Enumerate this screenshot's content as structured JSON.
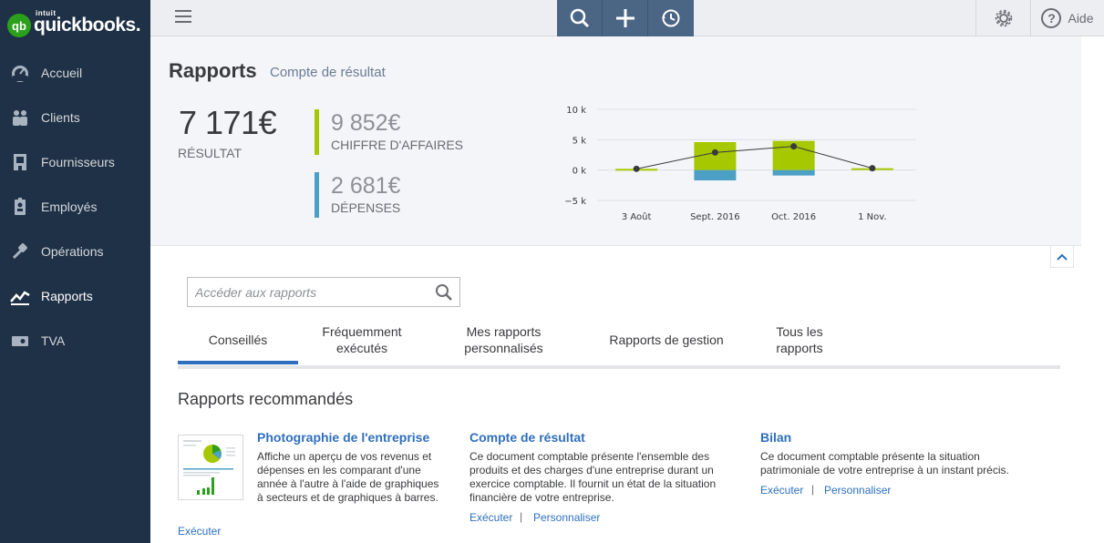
{
  "app": {
    "logo_badge": "qb",
    "logo_intuit": "intuit",
    "logo_name": "quickbooks."
  },
  "sidebar": {
    "items": [
      {
        "label": "Accueil",
        "icon": "dashboard-icon"
      },
      {
        "label": "Clients",
        "icon": "customers-icon"
      },
      {
        "label": "Fournisseurs",
        "icon": "vendors-icon"
      },
      {
        "label": "Employés",
        "icon": "employees-icon"
      },
      {
        "label": "Opérations",
        "icon": "transactions-icon"
      },
      {
        "label": "Rapports",
        "icon": "reports-icon",
        "active": true
      },
      {
        "label": "TVA",
        "icon": "tax-icon"
      }
    ]
  },
  "topbar": {
    "help_label": "Aide",
    "help_glyph": "?"
  },
  "header": {
    "title": "Rapports",
    "subtitle": "Compte de résultat",
    "result_value": "7 171€",
    "result_label": "RÉSULTAT",
    "revenue_value": "9 852€",
    "revenue_label": "CHIFFRE D'AFFAIRES",
    "expenses_value": "2 681€",
    "expenses_label": "DÉPENSES"
  },
  "chart_data": {
    "type": "bar",
    "categories": [
      "3 Août",
      "Sept. 2016",
      "Oct. 2016",
      "1 Nov."
    ],
    "series": [
      {
        "values": [
          200,
          4600,
          4800,
          300
        ],
        "color": "#a6c800"
      },
      {
        "values": [
          0,
          -1700,
          -900,
          0
        ],
        "color": "#4c9fc5"
      },
      {
        "values": [
          200,
          2900,
          3900,
          300
        ],
        "color": "#393a3d",
        "kind": "line"
      }
    ],
    "y_ticks": [
      "10 k",
      "5 k",
      "0 k",
      "−5 k"
    ],
    "ylim": [
      -5000,
      10000
    ],
    "grid": true
  },
  "search": {
    "placeholder": "Accéder aux rapports"
  },
  "tabs": [
    {
      "label": "Conseillés",
      "active": true
    },
    {
      "label": "Fréquemment exécutés"
    },
    {
      "label": "Mes rapports personnalisés"
    },
    {
      "label": "Rapports de gestion"
    },
    {
      "label": "Tous les rapports"
    }
  ],
  "recommended": {
    "title": "Rapports recommandés",
    "cards": [
      {
        "title": "Photographie de l'entreprise",
        "desc": "Affiche un aperçu de vos revenus et dépenses en les comparant d'une année à l'autre à l'aide de graphiques à secteurs et de graphiques à barres.",
        "run": "Exécuter"
      },
      {
        "title": "Compte de résultat",
        "desc": "Ce document comptable présente l'ensemble des produits et des charges d'une entreprise durant un exercice comptable. Il fournit un état de la situation financière de votre entreprise.",
        "run": "Exécuter",
        "customize": "Personnaliser",
        "sep": "|"
      },
      {
        "title": "Bilan",
        "desc": "Ce document comptable présente la situation patrimoniale de votre entreprise à un instant précis.",
        "run": "Exécuter",
        "customize": "Personnaliser",
        "sep": "|"
      }
    ]
  }
}
